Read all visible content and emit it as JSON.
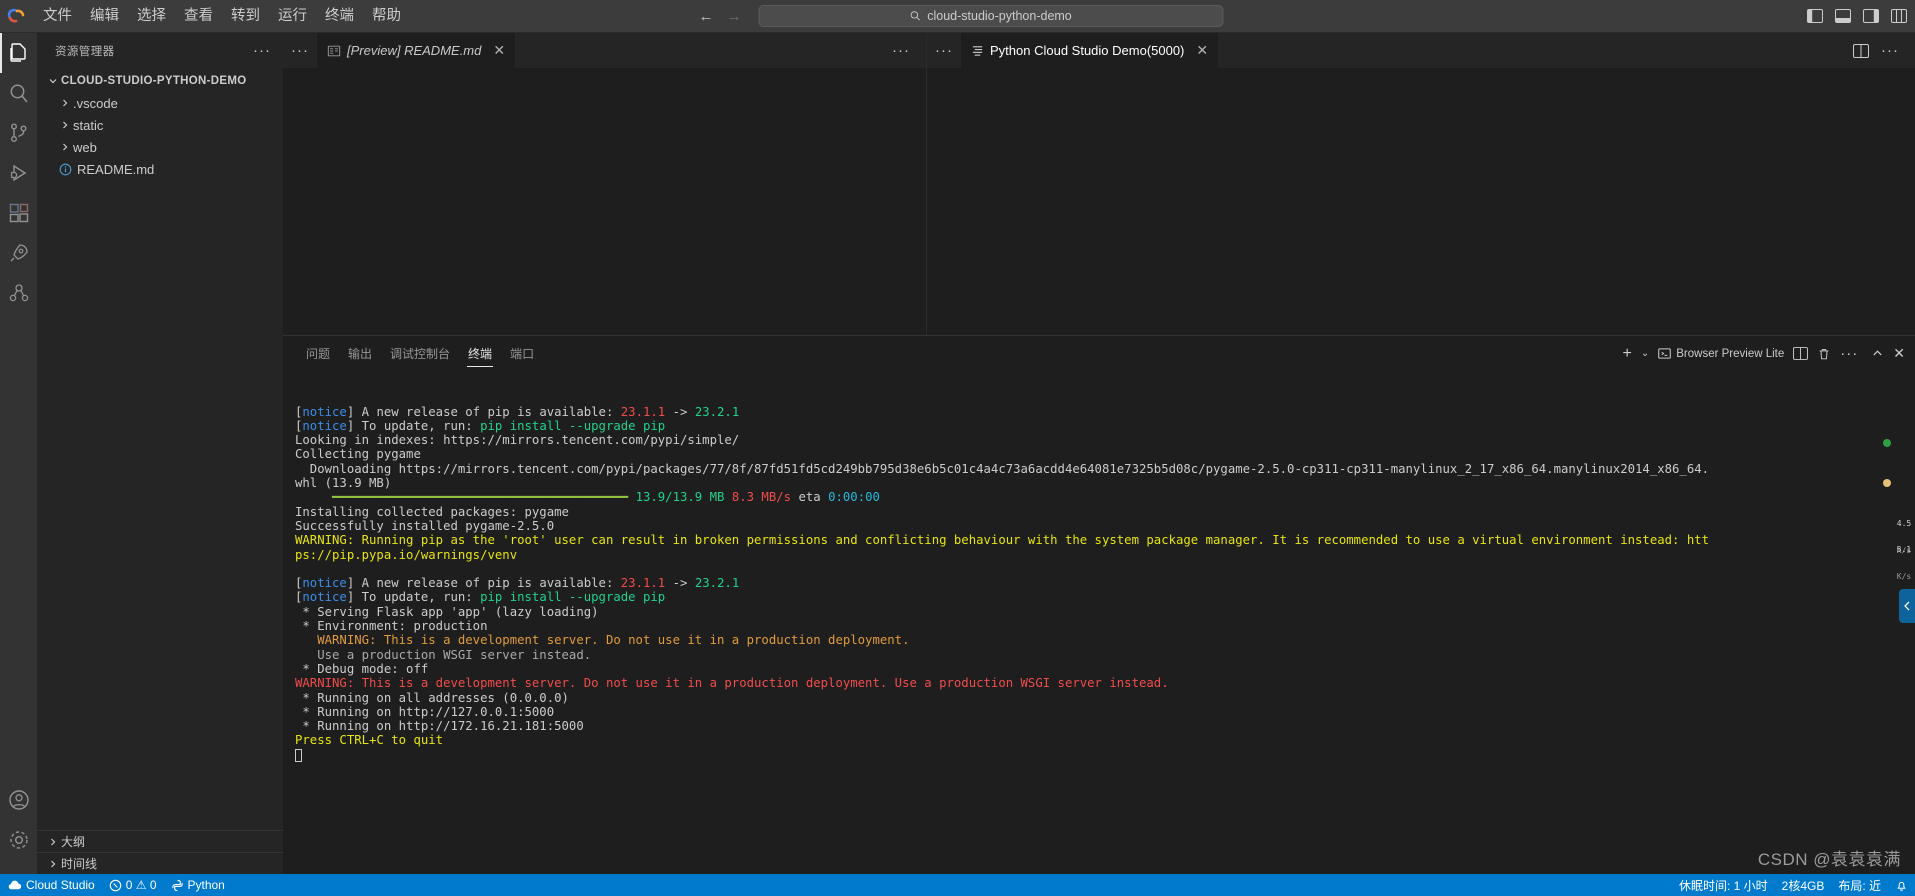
{
  "titlebar": {
    "menu": [
      "文件",
      "编辑",
      "选择",
      "查看",
      "转到",
      "运行",
      "终端",
      "帮助"
    ],
    "command_center_text": "cloud-studio-python-demo",
    "back_arrow": "←",
    "forward_arrow": "→"
  },
  "activitybar": {
    "items": [
      {
        "name": "explorer",
        "icon": "files-icon"
      },
      {
        "name": "search",
        "icon": "search-icon"
      },
      {
        "name": "source-control",
        "icon": "source-control-icon"
      },
      {
        "name": "run-debug",
        "icon": "run-debug-icon"
      },
      {
        "name": "extensions",
        "icon": "extensions-icon"
      },
      {
        "name": "rocket",
        "icon": "rocket-icon"
      },
      {
        "name": "remote",
        "icon": "remote-icon"
      }
    ],
    "bottom": [
      {
        "name": "accounts",
        "icon": "account-icon"
      },
      {
        "name": "settings",
        "icon": "gear-icon"
      }
    ]
  },
  "sidebar": {
    "title": "资源管理器",
    "more_label": "···",
    "root": "CLOUD-STUDIO-PYTHON-DEMO",
    "tree": [
      {
        "label": ".vscode",
        "type": "folder"
      },
      {
        "label": "static",
        "type": "folder"
      },
      {
        "label": "web",
        "type": "folder"
      },
      {
        "label": "README.md",
        "type": "file"
      }
    ],
    "bottom_sections": [
      "大纲",
      "时间线"
    ]
  },
  "editor": {
    "group_left": {
      "more_label": "···",
      "tab": {
        "label": "[Preview] README.md",
        "icon": "preview-icon",
        "close": "✕"
      },
      "actions_more": "···"
    },
    "group_right": {
      "more_label": "···",
      "tab": {
        "label": "Python Cloud Studio Demo(5000)",
        "icon": "lines-icon",
        "close": "✕"
      },
      "split_label": "split-editor-icon",
      "actions_more": "···"
    }
  },
  "panel": {
    "tabs": [
      {
        "label": "问题",
        "active": false
      },
      {
        "label": "输出",
        "active": false
      },
      {
        "label": "调试控制台",
        "active": false
      },
      {
        "label": "终端",
        "active": true
      },
      {
        "label": "端口",
        "active": false
      }
    ],
    "actions": {
      "new_terminal": "+",
      "new_terminal_dropdown": "⌄",
      "browser_preview_lite": "Browser Preview Lite",
      "split": "split-icon",
      "kill": "trash-icon",
      "more": "···",
      "maximize": "chevron-up-icon",
      "close": "✕"
    },
    "gauges": [
      {
        "value": "4.5",
        "unit": "K/s"
      },
      {
        "value": "5.1",
        "unit": "K/s"
      }
    ]
  },
  "terminal": {
    "lines": [
      [
        {
          "t": "[",
          "c": "white"
        },
        {
          "t": "notice",
          "c": "blue"
        },
        {
          "t": "] A new release of pip is available: ",
          "c": "white"
        },
        {
          "t": "23.1.1",
          "c": "red"
        },
        {
          "t": " -> ",
          "c": "white"
        },
        {
          "t": "23.2.1",
          "c": "green"
        }
      ],
      [
        {
          "t": "[",
          "c": "white"
        },
        {
          "t": "notice",
          "c": "blue"
        },
        {
          "t": "] To update, run: ",
          "c": "white"
        },
        {
          "t": "pip install --upgrade pip",
          "c": "green"
        }
      ],
      [
        {
          "t": "Looking in indexes: https://mirrors.tencent.com/pypi/simple/",
          "c": "white"
        }
      ],
      [
        {
          "t": "Collecting pygame",
          "c": "white"
        }
      ],
      [
        {
          "t": "  Downloading https://mirrors.tencent.com/pypi/packages/77/8f/87fd51fd5cd249bb795d38e6b5c01c4a4c73a6acdd4e64081e7325b5d08c/pygame-2.5.0-cp311-cp311-manylinux_2_17_x86_64.manylinux2014_x86_64.",
          "c": "white"
        }
      ],
      [
        {
          "t": "whl (13.9 MB)",
          "c": "white"
        }
      ],
      [
        {
          "t": "     ━━━━━━━━━━━━━━━━━━━━━━━━━━━━━━━━━━━━━━━━ ",
          "c": "bar"
        },
        {
          "t": "13.9/13.9 MB",
          "c": "green"
        },
        {
          "t": " ",
          "c": "white"
        },
        {
          "t": "8.3 MB/s",
          "c": "red"
        },
        {
          "t": " eta ",
          "c": "white"
        },
        {
          "t": "0:00:00",
          "c": "cyan"
        }
      ],
      [
        {
          "t": "Installing collected packages: pygame",
          "c": "white"
        }
      ],
      [
        {
          "t": "Successfully installed pygame-2.5.0",
          "c": "white"
        }
      ],
      [
        {
          "t": "WARNING: Running pip as the 'root' user can result in broken permissions and conflicting behaviour with the system package manager. It is recommended to use a virtual environment instead: htt",
          "c": "yellow"
        }
      ],
      [
        {
          "t": "ps://pip.pypa.io/warnings/venv",
          "c": "yellow"
        }
      ],
      [
        {
          "t": "",
          "c": "white"
        }
      ],
      [
        {
          "t": "[",
          "c": "white"
        },
        {
          "t": "notice",
          "c": "blue"
        },
        {
          "t": "] A new release of pip is available: ",
          "c": "white"
        },
        {
          "t": "23.1.1",
          "c": "red"
        },
        {
          "t": " -> ",
          "c": "white"
        },
        {
          "t": "23.2.1",
          "c": "green"
        }
      ],
      [
        {
          "t": "[",
          "c": "white"
        },
        {
          "t": "notice",
          "c": "blue"
        },
        {
          "t": "] To update, run: ",
          "c": "white"
        },
        {
          "t": "pip install --upgrade pip",
          "c": "green"
        }
      ],
      [
        {
          "t": " * Serving Flask app 'app' (lazy loading)",
          "c": "white"
        }
      ],
      [
        {
          "t": " * Environment: production",
          "c": "white"
        }
      ],
      [
        {
          "t": "   WARNING: This is a development server. Do not use it in a production deployment.",
          "c": "orange"
        }
      ],
      [
        {
          "t": "   Use a production WSGI server instead.",
          "c": "dim"
        }
      ],
      [
        {
          "t": " * Debug mode: off",
          "c": "white"
        }
      ],
      [
        {
          "t": "WARNING: This is a development server. Do not use it in a production deployment. Use a production WSGI server instead.",
          "c": "red"
        }
      ],
      [
        {
          "t": " * Running on all addresses (0.0.0.0)",
          "c": "white"
        }
      ],
      [
        {
          "t": " * Running on http://127.0.0.1:5000",
          "c": "white"
        }
      ],
      [
        {
          "t": " * Running on http://172.16.21.181:5000",
          "c": "white"
        }
      ],
      [
        {
          "t": "Press CTRL+C to quit",
          "c": "yellow"
        }
      ]
    ]
  },
  "statusbar": {
    "left": [
      {
        "icon": "cloud-icon",
        "label": "Cloud Studio"
      },
      {
        "icon": "error-warning-icon",
        "label": "0 ⚠ 0"
      },
      {
        "icon": "python-icon",
        "label": "Python"
      }
    ],
    "right": [
      {
        "label": "休眠时间: 1 小时"
      },
      {
        "label": "2核4GB"
      },
      {
        "label": "布局: 近"
      },
      {
        "icon": "bell-icon",
        "label": ""
      }
    ]
  },
  "watermark": "CSDN @袁袁袁满",
  "colors": {
    "accent": "#007acc",
    "titlebar_bg": "#3c3c3c",
    "sidebar_bg": "#252526",
    "editor_bg": "#1e1e1e",
    "activitybar_bg": "#333333"
  }
}
